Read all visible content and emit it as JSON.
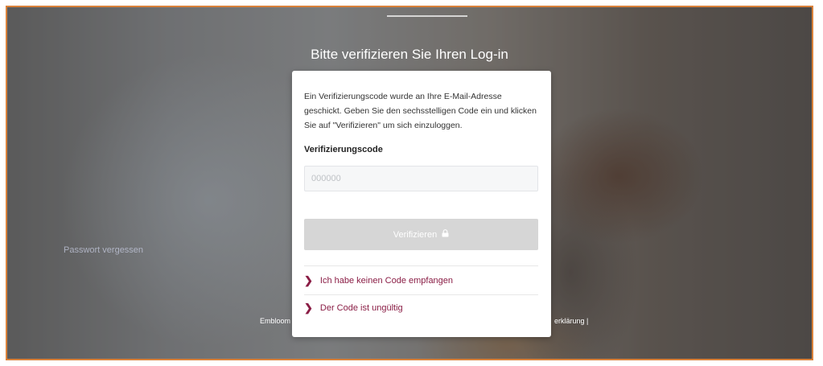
{
  "page": {
    "title": "Bitte verifizieren Sie Ihren Log-in",
    "footer_left": "Embloom |",
    "footer_right": "erklärung |",
    "background_link": "Passwort vergessen"
  },
  "card": {
    "intro": "Ein Verifizierungscode wurde an Ihre E-Mail-Adresse geschickt. Geben Sie den sechsstelligen Code ein und klicken Sie auf \"Verifizieren\" um sich einzuloggen.",
    "code_label": "Verifizierungscode",
    "code_placeholder": "000000",
    "code_value": "",
    "verify_button": "Verifizieren",
    "links": [
      {
        "label": "Ich habe keinen Code empfangen"
      },
      {
        "label": "Der Code ist ungültig"
      }
    ]
  },
  "colors": {
    "accent": "#8a1d45",
    "button_disabled": "#d6d6d6",
    "frame_border": "#d9813a"
  },
  "icons": {
    "verify_button_icon": "lock-icon",
    "link_icon": "chevron-right-icon"
  }
}
